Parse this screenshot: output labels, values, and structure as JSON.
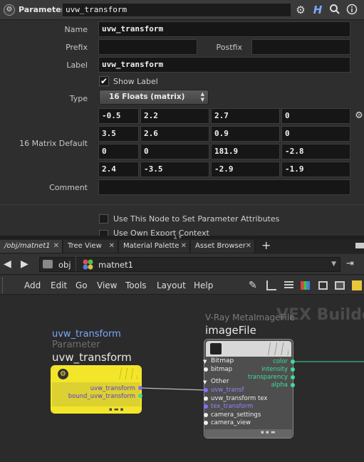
{
  "header": {
    "title": "Parameter",
    "node_name": "uvw_transform"
  },
  "form": {
    "name_label": "Name",
    "name_value": "uvw_transform",
    "prefix_label": "Prefix",
    "prefix_value": "",
    "postfix_label": "Postfix",
    "postfix_value": "",
    "label_label": "Label",
    "label_value": "uvw_transform",
    "show_label": "Show Label",
    "type_label": "Type",
    "type_value": "16 Floats (matrix)",
    "matrix_label": "16 Matrix Default",
    "matrix": [
      [
        "-0.5",
        "2.2",
        "2.7",
        "0"
      ],
      [
        "3.5",
        "2.6",
        "0.9",
        "0"
      ],
      [
        "0",
        "0",
        "181.9",
        "-2.8"
      ],
      [
        "2.4",
        "-3.5",
        "-2.9",
        "-1.9"
      ]
    ],
    "comment_label": "Comment",
    "comment_value": "",
    "use_node_label": "Use This Node to Set Parameter Attributes",
    "use_export_label": "Use Own Export Context"
  },
  "tabs": [
    {
      "label": "/obj/matnet1"
    },
    {
      "label": "Tree View"
    },
    {
      "label": "Material Palette"
    },
    {
      "label": "Asset Browser"
    }
  ],
  "path": {
    "seg1": "obj",
    "seg2": "matnet1"
  },
  "menu": [
    "Add",
    "Edit",
    "Go",
    "View",
    "Tools",
    "Layout",
    "Help"
  ],
  "network": {
    "watermark": "VEX Builder",
    "param_node": {
      "title_top": "uvw_transform",
      "type": "Parameter",
      "title": "uvw_transform",
      "outputs": [
        "uvw_transform",
        "bound_uvw_transform"
      ]
    },
    "image_node": {
      "type": "V-Ray MetaImageFile",
      "title": "imageFile",
      "outputs": [
        "color",
        "intensity",
        "transparency",
        "alpha"
      ],
      "group1": "Bitmap",
      "inputs1": [
        "bitmap"
      ],
      "group2": "Other",
      "inputs2": [
        "uvw_transf",
        "uvw_transform tex",
        "tex_transform",
        "camera_settings",
        "camera_view"
      ]
    }
  },
  "colors": {
    "param_node": "#f3e62a",
    "accent_blue": "#6fa3ff",
    "port_purple": "#8a6cff",
    "port_green": "#3ddc97",
    "node_grey": "#5a5a5a"
  }
}
